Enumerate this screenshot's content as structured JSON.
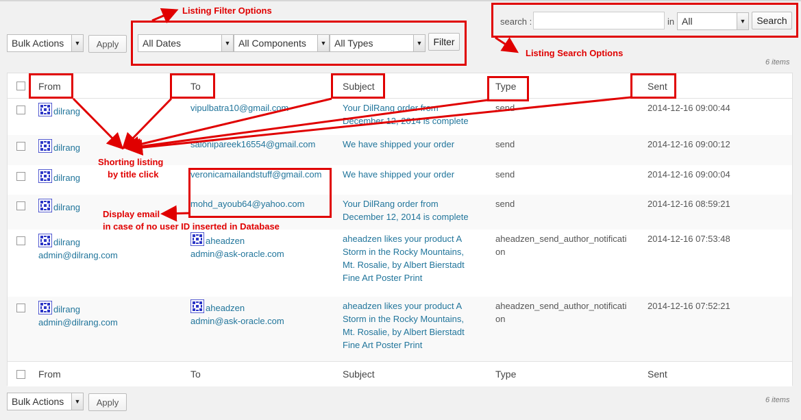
{
  "top_actions": {
    "bulk_label": "Bulk Actions",
    "apply_label": "Apply",
    "dates_filter": "All Dates",
    "components_filter": "All Components",
    "types_filter": "All Types",
    "filter_label": "Filter",
    "item_count": "6 items"
  },
  "search": {
    "label": "search :",
    "value": "",
    "in_label": "in",
    "scope": "All",
    "button": "Search"
  },
  "columns": [
    "From",
    "To",
    "Subject",
    "Type",
    "Sent"
  ],
  "rows": [
    {
      "from_name": "dilrang",
      "from_email": "",
      "to_name": "",
      "to_email": "vipulbatra10@gmail.com",
      "subject": [
        "Your DilRang order from",
        "December 12, 2014 is complete"
      ],
      "type": [
        "send"
      ],
      "sent": "2014-12-16 09:00:44"
    },
    {
      "from_name": "dilrang",
      "from_email": "",
      "to_name": "",
      "to_email": "salonipareek16554@gmail.com",
      "subject": [
        "We have shipped your order"
      ],
      "type": [
        "send"
      ],
      "sent": "2014-12-16 09:00:12"
    },
    {
      "from_name": "dilrang",
      "from_email": "",
      "to_name": "",
      "to_email": "veronicamailandstuff@gmail.com",
      "subject": [
        "We have shipped your order"
      ],
      "type": [
        "send"
      ],
      "sent": "2014-12-16 09:00:04"
    },
    {
      "from_name": "dilrang",
      "from_email": "",
      "to_name": "",
      "to_email": "mohd_ayoub64@yahoo.com",
      "subject": [
        "Your DilRang order from",
        "December 12, 2014 is complete"
      ],
      "type": [
        "send"
      ],
      "sent": "2014-12-16 08:59:21"
    },
    {
      "from_name": "dilrang",
      "from_email": "admin@dilrang.com",
      "to_name": "aheadzen",
      "to_email": "admin@ask-oracle.com",
      "subject": [
        "aheadzen likes your product A",
        "Storm in the Rocky Mountains,",
        "Mt. Rosalie, by Albert Bierstadt",
        "Fine Art Poster Print"
      ],
      "type": [
        "aheadzen_send_author_notificati",
        "on"
      ],
      "sent": "2014-12-16 07:53:48"
    },
    {
      "from_name": "dilrang",
      "from_email": "admin@dilrang.com",
      "to_name": "aheadzen",
      "to_email": "admin@ask-oracle.com",
      "subject": [
        "aheadzen likes your product A",
        "Storm in the Rocky Mountains,",
        "Mt. Rosalie, by Albert Bierstadt",
        "Fine Art Poster Print"
      ],
      "type": [
        "aheadzen_send_author_notificati",
        "on"
      ],
      "sent": "2014-12-16 07:52:21"
    }
  ],
  "bottom_actions": {
    "bulk_label": "Bulk Actions",
    "apply_label": "Apply",
    "item_count": "6 items"
  },
  "annotations": {
    "filter_options": "Listing Filter Options",
    "search_options": "Listing Search Options",
    "sorting_line1": "Shorting listing",
    "sorting_line2": "by title click",
    "email_line1": "Display email",
    "email_line2": "in case of no user ID inserted in Database"
  },
  "colors": {
    "annotation": "#e00000",
    "link": "#21759b"
  }
}
